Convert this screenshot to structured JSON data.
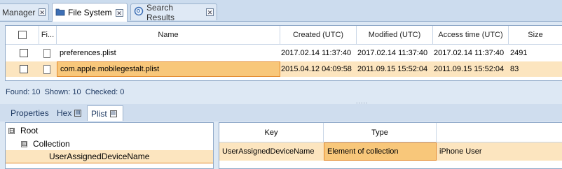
{
  "tabs": [
    {
      "label": "Manager",
      "icon": "none"
    },
    {
      "label": "File System",
      "icon": "folder-icon"
    },
    {
      "label": "Search Results",
      "icon": "search-icon"
    }
  ],
  "grid": {
    "headers": [
      "",
      "Fi...",
      "Name",
      "Created (UTC)",
      "Modified (UTC)",
      "Access time (UTC)",
      "Size"
    ],
    "rows": [
      {
        "name": "preferences.plist",
        "created": "2017.02.14 11:37:40",
        "modified": "2017.02.14 11:37:40",
        "access": "2017.02.14 11:37:40",
        "size": "2491"
      },
      {
        "name": "com.apple.mobilegestalt.plist",
        "created": "2015.04.12 04:09:58",
        "modified": "2011.09.15 15:52:04",
        "access": "2011.09.15 15:52:04",
        "size": "83"
      }
    ]
  },
  "status": "Found: 10  Shown: 10  Checked: 0",
  "splitter": ".....",
  "bottom_tabs": [
    "Properties",
    "Hex",
    "Plist"
  ],
  "tree": {
    "root": "Root",
    "collection": "Collection",
    "leaf": "UserAssignedDeviceName",
    "collapse_glyph": "⊟"
  },
  "key_table": {
    "headers": [
      "Key",
      "Type",
      ""
    ],
    "row": {
      "key": "UserAssignedDeviceName",
      "type": "Element of collection",
      "value": "iPhone User"
    }
  },
  "colors": {
    "selection": "#fce5bf",
    "focus": "#f8c77a",
    "accent_border": "#e48a2c",
    "frame": "#8fa9c8"
  }
}
